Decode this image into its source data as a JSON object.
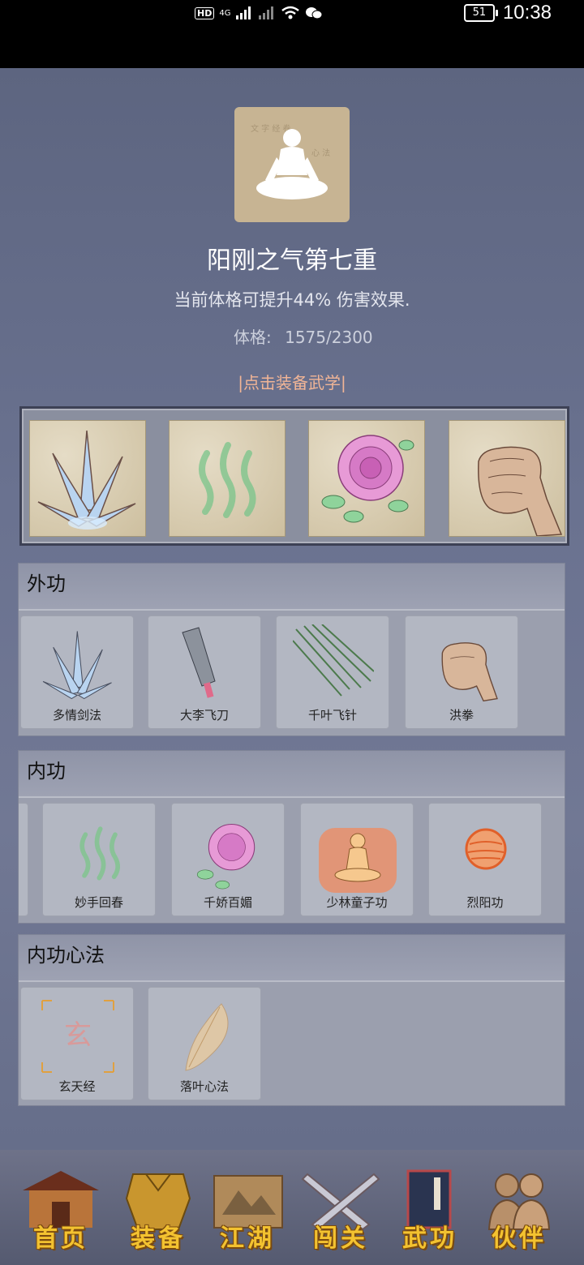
{
  "status_bar": {
    "time": "10:38",
    "battery": "51",
    "hd": "HD",
    "network": "4G"
  },
  "header": {
    "title": "阳刚之气第七重",
    "description": "当前体格可提升44% 伤害效果.",
    "stat_label": "体格:",
    "stat_value": "1575/2300",
    "equip_link": "|点击装备武学|"
  },
  "equipped_slots": [
    {
      "icon": "crystal-sword-icon"
    },
    {
      "icon": "green-qi-icon"
    },
    {
      "icon": "rose-icon"
    },
    {
      "icon": "fist-icon"
    }
  ],
  "sections": {
    "outer": {
      "title": "外功",
      "skills": [
        {
          "label": "多情剑法",
          "icon": "crystal-sword-icon"
        },
        {
          "label": "大李飞刀",
          "icon": "cleaver-icon"
        },
        {
          "label": "千叶飞针",
          "icon": "needles-icon"
        },
        {
          "label": "洪拳",
          "icon": "fist-icon"
        }
      ]
    },
    "inner": {
      "title": "内功",
      "skills": [
        {
          "label": "妙手回春",
          "icon": "green-qi-icon"
        },
        {
          "label": "千娇百媚",
          "icon": "rose-icon"
        },
        {
          "label": "少林童子功",
          "icon": "monk-icon"
        },
        {
          "label": "烈阳功",
          "icon": "sun-orb-icon"
        }
      ]
    },
    "mind": {
      "title": "内功心法",
      "skills": [
        {
          "label": "玄天经",
          "icon": "xuan-rune-icon",
          "glyph": "玄"
        },
        {
          "label": "落叶心法",
          "icon": "leaf-icon"
        }
      ]
    }
  },
  "bottom_nav": [
    {
      "label": "首页",
      "icon": "house-icon"
    },
    {
      "label": "装备",
      "icon": "armor-icon"
    },
    {
      "label": "江湖",
      "icon": "scroll-map-icon"
    },
    {
      "label": "闯关",
      "icon": "crossed-swords-icon"
    },
    {
      "label": "武功",
      "icon": "book-icon"
    },
    {
      "label": "伙伴",
      "icon": "companions-icon"
    }
  ],
  "colors": {
    "background": "#5f6780",
    "link": "#f1b596",
    "nav_text": "#f3c230"
  }
}
